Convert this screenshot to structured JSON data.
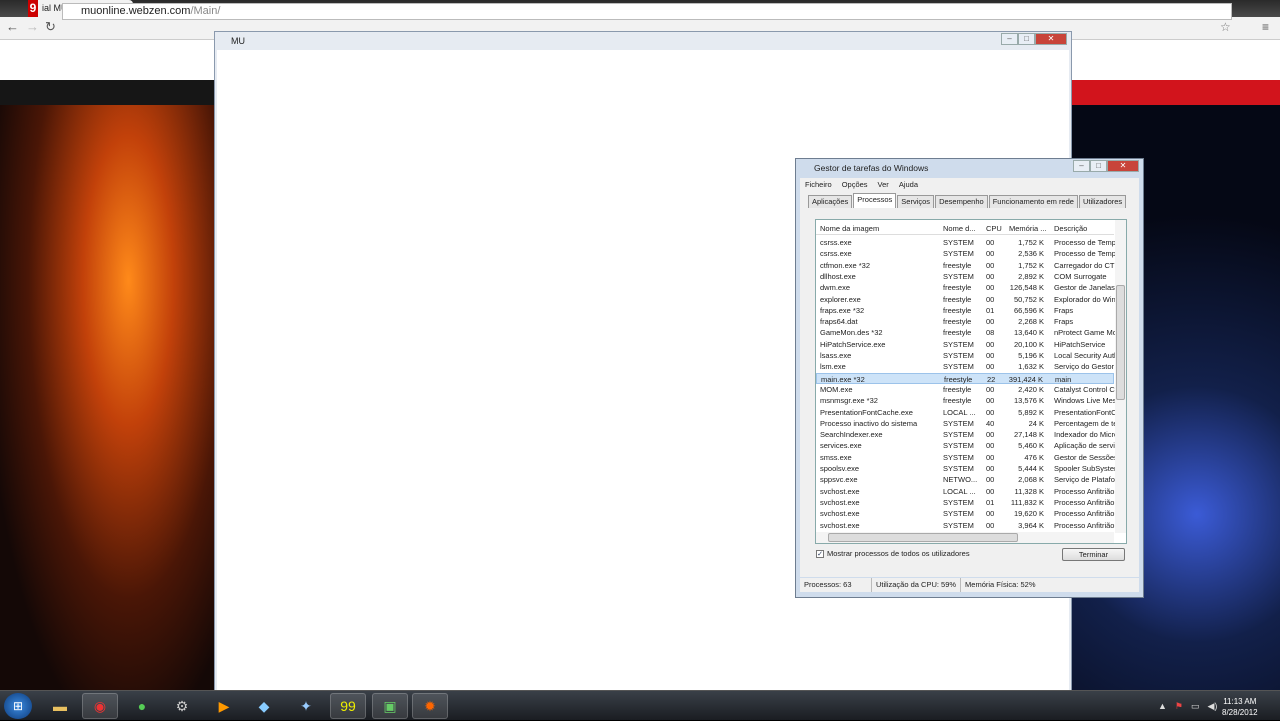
{
  "browser": {
    "tab_title": "ial MU Online",
    "favicon_letter": "9",
    "tab_close": "×",
    "url_host": "muonline.webzen.com",
    "url_path": "/Main/"
  },
  "mu_window": {
    "title": "MU"
  },
  "task_manager": {
    "title": "Gestor de tarefas do Windows",
    "menu": [
      "Ficheiro",
      "Opções",
      "Ver",
      "Ajuda"
    ],
    "tabs": [
      "Aplicações",
      "Processos",
      "Serviços",
      "Desempenho",
      "Funcionamento em rede",
      "Utilizadores"
    ],
    "active_tab": "Processos",
    "columns": [
      "Nome da imagem",
      "Nome d...",
      "CPU",
      "Memória ...",
      "Descrição"
    ],
    "rows": [
      [
        "csrss.exe",
        "SYSTEM",
        "00",
        "1,752 K",
        "Processo de Tempo"
      ],
      [
        "csrss.exe",
        "SYSTEM",
        "00",
        "2,536 K",
        "Processo de Tempo"
      ],
      [
        "ctfmon.exe *32",
        "freestyle",
        "00",
        "1,752 K",
        "Carregador do CTF"
      ],
      [
        "dllhost.exe",
        "SYSTEM",
        "00",
        "2,892 K",
        "COM Surrogate"
      ],
      [
        "dwm.exe",
        "freestyle",
        "00",
        "126,548 K",
        "Gestor de Janelas"
      ],
      [
        "explorer.exe",
        "freestyle",
        "00",
        "50,752 K",
        "Explorador do Windows"
      ],
      [
        "fraps.exe *32",
        "freestyle",
        "01",
        "66,596 K",
        "Fraps"
      ],
      [
        "fraps64.dat",
        "freestyle",
        "00",
        "2,268 K",
        "Fraps"
      ],
      [
        "GameMon.des *32",
        "freestyle",
        "08",
        "13,640 K",
        "nProtect Game Mon"
      ],
      [
        "HiPatchService.exe",
        "SYSTEM",
        "00",
        "20,100 K",
        "HiPatchService"
      ],
      [
        "lsass.exe",
        "SYSTEM",
        "00",
        "5,196 K",
        "Local Security Auth"
      ],
      [
        "lsm.exe",
        "SYSTEM",
        "00",
        "1,632 K",
        "Serviço do Gestor"
      ],
      [
        "main.exe *32",
        "freestyle",
        "22",
        "391,424 K",
        "main"
      ],
      [
        "MOM.exe",
        "freestyle",
        "00",
        "2,420 K",
        "Catalyst Control C"
      ],
      [
        "msnmsgr.exe *32",
        "freestyle",
        "00",
        "13,576 K",
        "Windows Live Mess"
      ],
      [
        "PresentationFontCache.exe",
        "LOCAL ...",
        "00",
        "5,892 K",
        "PresentationFontC"
      ],
      [
        "Processo inactivo do sistema",
        "SYSTEM",
        "40",
        "24 K",
        "Percentagem de te"
      ],
      [
        "SearchIndexer.exe",
        "SYSTEM",
        "00",
        "27,148 K",
        "Indexador do Micro"
      ],
      [
        "services.exe",
        "SYSTEM",
        "00",
        "5,460 K",
        "Aplicação de serviç"
      ],
      [
        "smss.exe",
        "SYSTEM",
        "00",
        "476 K",
        "Gestor de Sessões"
      ],
      [
        "spoolsv.exe",
        "SYSTEM",
        "00",
        "5,444 K",
        "Spooler SubSystem"
      ],
      [
        "sppsvc.exe",
        "NETWO...",
        "00",
        "2,068 K",
        "Serviço de Plataforma"
      ],
      [
        "svchost.exe",
        "LOCAL ...",
        "00",
        "11,328 K",
        "Processo Anfitrião"
      ],
      [
        "svchost.exe",
        "SYSTEM",
        "01",
        "111,832 K",
        "Processo Anfitrião"
      ],
      [
        "svchost.exe",
        "SYSTEM",
        "00",
        "19,620 K",
        "Processo Anfitrião"
      ],
      [
        "svchost.exe",
        "SYSTEM",
        "00",
        "3,964 K",
        "Processo Anfitrião"
      ]
    ],
    "selected_row": 12,
    "show_all_label": "Mostrar processos de todos os utilizadores",
    "show_all_checked": true,
    "end_button": "Terminar",
    "status": {
      "processes": "Processos: 63",
      "cpu": "Utilização da CPU: 59%",
      "memory": "Memória Física: 52%"
    }
  },
  "taskbar": {
    "time": "11:13 AM",
    "date": "8/28/2012"
  }
}
